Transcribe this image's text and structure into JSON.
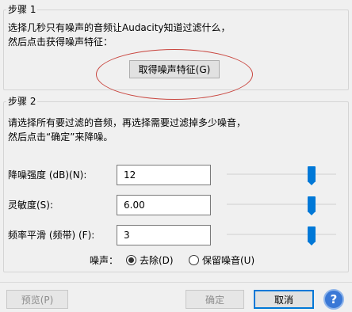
{
  "step1": {
    "title": "步骤 1",
    "line1": "选择几秒只有噪声的音频让Audacity知道过滤什么，",
    "line2": "然后点击获得噪声特征：",
    "button_label": "取得噪声特征(G)"
  },
  "step2": {
    "title": "步骤 2",
    "line1": "请选择所有要过滤的音频，再选择需要过滤掉多少噪音，",
    "line2": "然后点击“确定”来降噪。",
    "params": [
      {
        "label": "降噪强度 (dB)(N):",
        "value": "12",
        "slider_fraction": 0.8
      },
      {
        "label": "灵敏度(S):",
        "value": "6.00",
        "slider_fraction": 0.8
      },
      {
        "label": "频率平滑 (频带) (F):",
        "value": "3",
        "slider_fraction": 0.8
      }
    ],
    "noise_label": "噪声：",
    "radio_remove": "去除(D)",
    "radio_keep": "保留噪音(U)",
    "selected": "remove"
  },
  "footer": {
    "preview_label": "预览(P)",
    "ok_label": "确定",
    "cancel_label": "取消",
    "help_glyph": "?"
  },
  "colors": {
    "accent": "#0078d7",
    "highlight_circle": "#c9463f",
    "help_button": "#3a78d6"
  }
}
